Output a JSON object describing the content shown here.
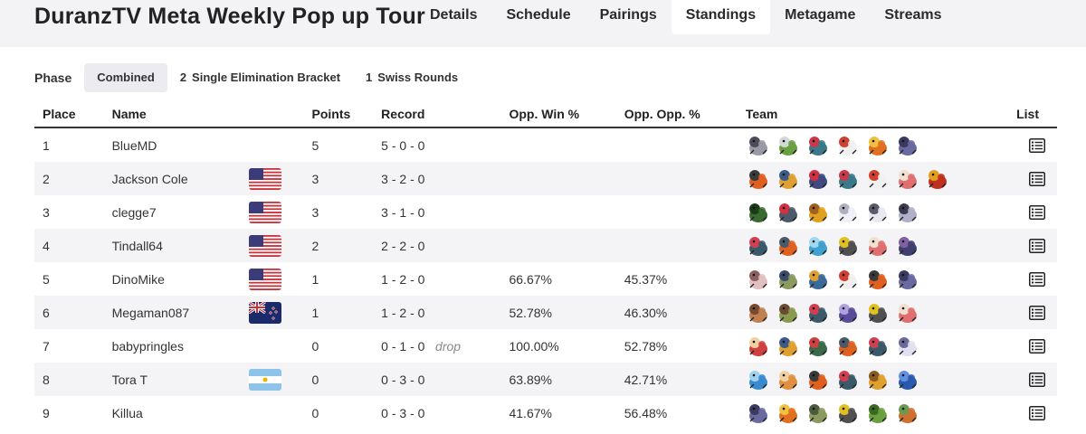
{
  "header": {
    "title": "DuranzTV Meta Weekly Pop up Tour",
    "tabs": [
      {
        "label": "Details",
        "active": false
      },
      {
        "label": "Schedule",
        "active": false
      },
      {
        "label": "Pairings",
        "active": false
      },
      {
        "label": "Standings",
        "active": true
      },
      {
        "label": "Metagame",
        "active": false
      },
      {
        "label": "Streams",
        "active": false
      }
    ]
  },
  "phase": {
    "label": "Phase",
    "options": [
      {
        "num": "",
        "label": "Combined",
        "active": true
      },
      {
        "num": "2",
        "label": "Single Elimination Bracket",
        "active": false
      },
      {
        "num": "1",
        "label": "Swiss Rounds",
        "active": false
      }
    ]
  },
  "columns": {
    "place": "Place",
    "name": "Name",
    "points": "Points",
    "record": "Record",
    "opp_win": "Opp. Win %",
    "opp_opp": "Opp. Opp. %",
    "team": "Team",
    "list": "List"
  },
  "rows": [
    {
      "place": "1",
      "name": "BlueMD",
      "flag": "",
      "points": "5",
      "record": "5 - 0 - 0",
      "drop": "",
      "opp_win": "",
      "opp_opp": "",
      "team": [
        [
          "#9a9aa6",
          "#4c4c58"
        ],
        [
          "#6aa040",
          "#d0d8d8"
        ],
        [
          "#3a7a8a",
          "#c83a4a"
        ],
        [
          "#f0f0f0",
          "#d04030"
        ],
        [
          "#e07020",
          "#f0c040"
        ],
        [
          "#6a6aa0",
          "#3a3a60"
        ]
      ]
    },
    {
      "place": "2",
      "name": "Jackson Cole",
      "flag": "us",
      "points": "3",
      "record": "3 - 2 - 0",
      "drop": "",
      "opp_win": "",
      "opp_opp": "",
      "team": [
        [
          "#e06020",
          "#3a3a3a"
        ],
        [
          "#e0a030",
          "#3a5a8a"
        ],
        [
          "#404a80",
          "#d03040"
        ],
        [
          "#3a7a8a",
          "#c83a4a"
        ],
        [
          "#f0f0f0",
          "#d04030"
        ],
        [
          "#e07070",
          "#f0e0d0"
        ],
        [
          "#c03020",
          "#e0a020"
        ]
      ]
    },
    {
      "place": "3",
      "name": "clegge7",
      "flag": "us",
      "points": "3",
      "record": "3 - 1 - 0",
      "drop": "",
      "opp_win": "",
      "opp_opp": "",
      "team": [
        [
          "#3a6a30",
          "#1a3a18"
        ],
        [
          "#4a5a6a",
          "#d03040"
        ],
        [
          "#e0a020",
          "#a06020"
        ],
        [
          "#f0f0f8",
          "#b0b0c0"
        ],
        [
          "#e8e8f0",
          "#5a5a6a"
        ],
        [
          "#b0b0c8",
          "#3a3a50"
        ]
      ]
    },
    {
      "place": "4",
      "name": "Tindall64",
      "flag": "us",
      "points": "2",
      "record": "2 - 2 - 0",
      "drop": "",
      "opp_win": "",
      "opp_opp": "",
      "team": [
        [
          "#3a5a6a",
          "#d04050"
        ],
        [
          "#e06020",
          "#4a5a6a"
        ],
        [
          "#40a0d0",
          "#a0d8f0"
        ],
        [
          "#505050",
          "#e0c020"
        ],
        [
          "#e07070",
          "#f0e0d0"
        ],
        [
          "#404070",
          "#8060a0"
        ]
      ]
    },
    {
      "place": "5",
      "name": "DinoMike",
      "flag": "us",
      "points": "1",
      "record": "1 - 2 - 0",
      "drop": "",
      "opp_win": "66.67%",
      "opp_opp": "45.37%",
      "team": [
        [
          "#e0c0c0",
          "#8a6060"
        ],
        [
          "#8a9a60",
          "#3a4a6a"
        ],
        [
          "#3a6a9a",
          "#e0a030"
        ],
        [
          "#f0f0f0",
          "#d04030"
        ],
        [
          "#e06020",
          "#3a3a3a"
        ],
        [
          "#6a6aa0",
          "#3a3a60"
        ]
      ]
    },
    {
      "place": "6",
      "name": "Megaman087",
      "flag": "nz",
      "points": "1",
      "record": "1 - 2 - 0",
      "drop": "",
      "opp_win": "52.78%",
      "opp_opp": "46.30%",
      "team": [
        [
          "#c08050",
          "#7a4a30"
        ],
        [
          "#8a9a50",
          "#6a4a30"
        ],
        [
          "#3a5a6a",
          "#d04050"
        ],
        [
          "#5a4a9a",
          "#b0a0e0"
        ],
        [
          "#505050",
          "#e0c020"
        ],
        [
          "#e07070",
          "#f0e0d0"
        ]
      ]
    },
    {
      "place": "7",
      "name": "babypringles",
      "flag": "",
      "points": "0",
      "record": "0 - 1 - 0",
      "drop": "drop",
      "opp_win": "100.00%",
      "opp_opp": "52.78%",
      "team": [
        [
          "#d04040",
          "#f0d0a0"
        ],
        [
          "#e0a030",
          "#3a5a8a"
        ],
        [
          "#3a6a4a",
          "#d04040"
        ],
        [
          "#e06020",
          "#4a5a6a"
        ],
        [
          "#3a5a6a",
          "#d04050"
        ],
        [
          "#e0e0f0",
          "#6a6a9a"
        ]
      ]
    },
    {
      "place": "8",
      "name": "Tora T",
      "flag": "ar",
      "points": "0",
      "record": "0 - 3 - 0",
      "drop": "",
      "opp_win": "63.89%",
      "opp_opp": "42.71%",
      "team": [
        [
          "#3a8ad0",
          "#a0d0f0"
        ],
        [
          "#e09040",
          "#f0d0a0"
        ],
        [
          "#e06020",
          "#3a3a3a"
        ],
        [
          "#3a5a6a",
          "#d04050"
        ],
        [
          "#e0a030",
          "#8a5a20"
        ],
        [
          "#2a5ab0",
          "#6090e0"
        ]
      ]
    },
    {
      "place": "9",
      "name": "Killua",
      "flag": "",
      "points": "0",
      "record": "0 - 3 - 0",
      "drop": "",
      "opp_win": "41.67%",
      "opp_opp": "56.48%",
      "team": [
        [
          "#6a6aa0",
          "#3a3a60"
        ],
        [
          "#e07020",
          "#f0c040"
        ],
        [
          "#8a9a60",
          "#4a5a3a"
        ],
        [
          "#505050",
          "#e0c020"
        ],
        [
          "#6aa040",
          "#3a6a20"
        ],
        [
          "#d07030",
          "#6a9a50"
        ]
      ]
    }
  ]
}
